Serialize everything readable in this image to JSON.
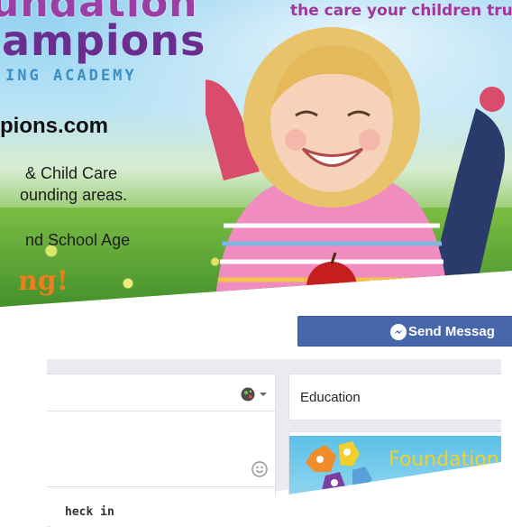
{
  "cover": {
    "logo_line1": "undation",
    "logo_line2": "ampions",
    "logo_line3": "ING ACADEMY",
    "website": "pions.com",
    "line1": "& Child Care",
    "line2": "ounding areas.",
    "line3": "nd School Age",
    "cta": "ng!",
    "tagline": "the care your children tru"
  },
  "actions": {
    "send_message": "Send Messag"
  },
  "composer": {
    "check_in": "heck in"
  },
  "sidebar": {
    "category": "Education",
    "logo_text": "Foundation"
  },
  "colors": {
    "facebook_blue": "#4867aa",
    "logo_purple": "#6b2d8f",
    "tagline_magenta": "#a0359e",
    "cta_orange": "#f07c1b"
  }
}
